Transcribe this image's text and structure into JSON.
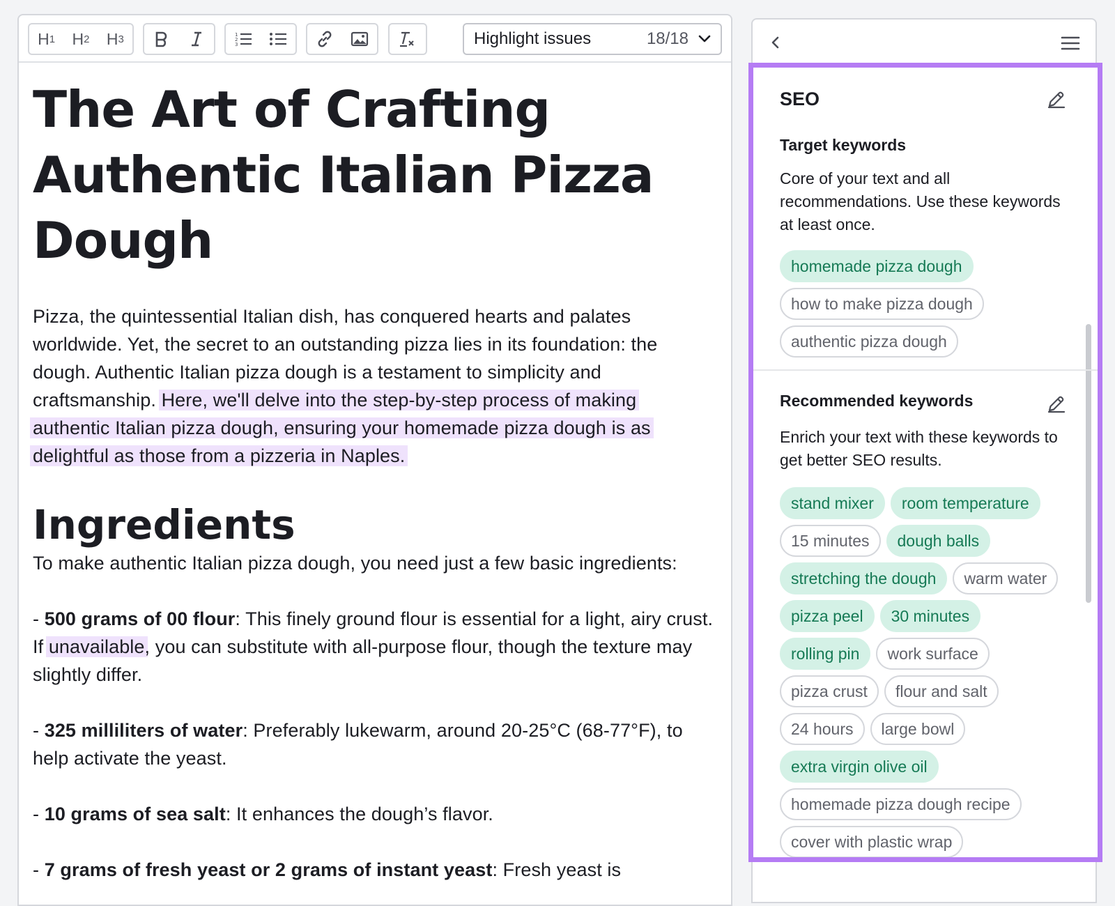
{
  "toolbar": {
    "h1": "H",
    "h1_sub": "1",
    "h2": "H",
    "h2_sub": "2",
    "h3": "H",
    "h3_sub": "3",
    "highlight_label": "Highlight issues",
    "highlight_count": "18/18"
  },
  "article": {
    "title": "The Art of Crafting Authentic Italian Pizza Dough",
    "intro_plain": "Pizza, the quintessential Italian dish, has conquered hearts and palates worldwide. Yet, the secret to an outstanding pizza lies in its foundation: the dough. Authentic Italian pizza dough is a testament to simplicity and craftsmanship. ",
    "intro_highlight": "Here, we'll delve into the step-by-step process of making authentic Italian pizza dough, ensuring your homemade pizza dough is as delightful as those from a pizzeria in Naples.",
    "ingredients_heading": "Ingredients",
    "ingredients_intro": "To make authentic Italian pizza dough, you need just a few basic ingredients:",
    "items": [
      {
        "dash": "- ",
        "bold": "500 grams of 00 flour",
        "text_before": ": This finely ground flour is essential for a light, airy crust. If ",
        "highlight": "unavailable",
        "text_after": ", you can substitute with all-purpose flour, though the texture may slightly differ."
      },
      {
        "dash": "- ",
        "bold": "325 milliliters of water",
        "text": ": Preferably lukewarm, around 20-25°C (68-77°F), to help activate the yeast."
      },
      {
        "dash": "- ",
        "bold": "10 grams of sea salt",
        "text": ": It enhances the dough’s flavor."
      },
      {
        "dash": "- ",
        "bold": "7 grams of fresh yeast or 2 grams of instant yeast",
        "text": ": Fresh yeast is"
      }
    ]
  },
  "seo": {
    "title": "SEO",
    "target_title": "Target keywords",
    "target_desc": "Core of your text and all recommendations. Use these keywords at least once.",
    "target_keywords": [
      {
        "label": "homemade pizza dough",
        "used": true
      },
      {
        "label": "how to make pizza dough",
        "used": false
      },
      {
        "label": "authentic pizza dough",
        "used": false
      }
    ],
    "recommended_title": "Recommended keywords",
    "recommended_desc": "Enrich your text with these keywords to get better SEO results.",
    "recommended_keywords": [
      {
        "label": "stand mixer",
        "used": true
      },
      {
        "label": "room temperature",
        "used": true
      },
      {
        "label": "15 minutes",
        "used": false
      },
      {
        "label": "dough balls",
        "used": true
      },
      {
        "label": "stretching the dough",
        "used": true
      },
      {
        "label": "warm water",
        "used": false
      },
      {
        "label": "pizza peel",
        "used": true
      },
      {
        "label": "30 minutes",
        "used": true
      },
      {
        "label": "rolling pin",
        "used": true
      },
      {
        "label": "work surface",
        "used": false
      },
      {
        "label": "pizza crust",
        "used": false
      },
      {
        "label": "flour and salt",
        "used": false
      },
      {
        "label": "24 hours",
        "used": false
      },
      {
        "label": "large bowl",
        "used": false
      },
      {
        "label": "extra virgin olive oil",
        "used": true
      },
      {
        "label": "homemade pizza dough recipe",
        "used": false
      },
      {
        "label": "cover with plastic wrap",
        "used": false
      }
    ]
  },
  "colors": {
    "accent_border": "#b57cf4",
    "highlight_bg": "#efe2fc",
    "chip_used_bg": "#d4f1e6",
    "chip_used_text": "#167a55"
  },
  "icons": [
    "bold-icon",
    "italic-icon",
    "ordered-list-icon",
    "bullet-list-icon",
    "link-icon",
    "image-icon",
    "clear-format-icon",
    "chevron-down-icon",
    "chevron-left-icon",
    "hamburger-menu-icon",
    "pencil-edit-icon"
  ]
}
